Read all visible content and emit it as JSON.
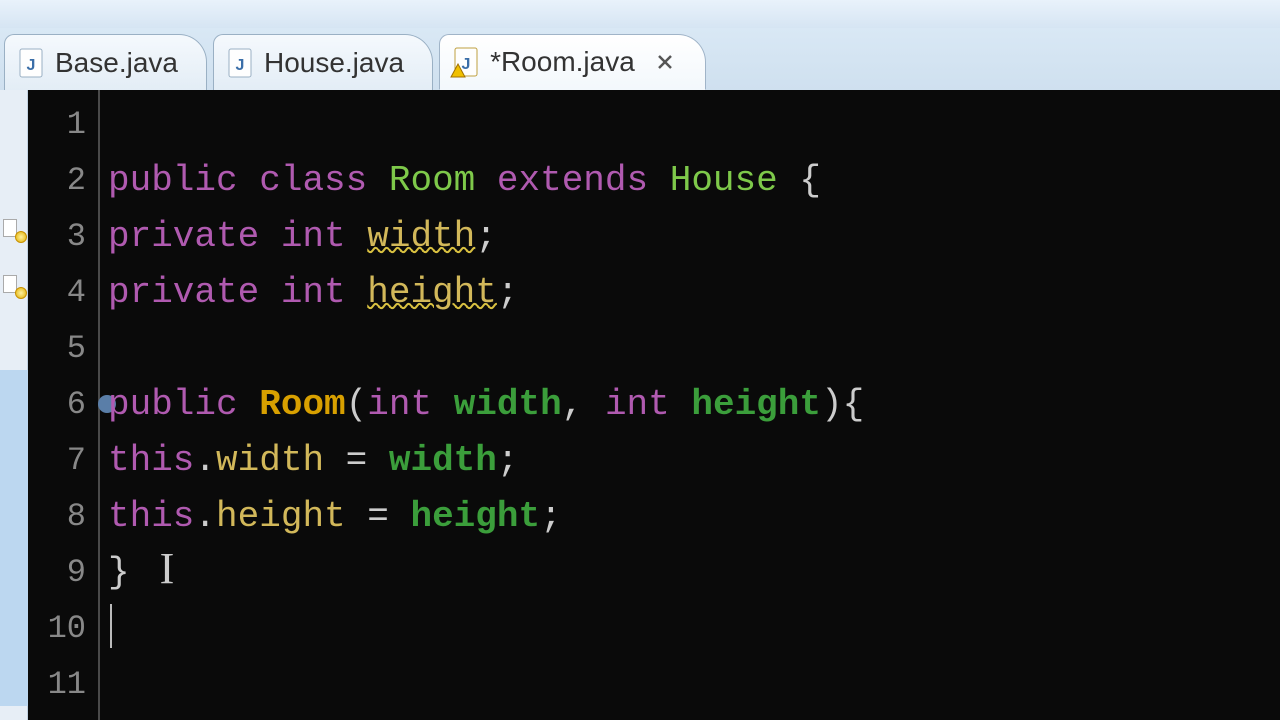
{
  "tabs": [
    {
      "label": "Base.java",
      "active": false,
      "dirty": false,
      "hasWarning": false
    },
    {
      "label": "House.java",
      "active": false,
      "dirty": false,
      "hasWarning": false
    },
    {
      "label": "*Room.java",
      "active": true,
      "dirty": true,
      "hasWarning": true
    }
  ],
  "gutter": {
    "start": 1,
    "end": 11,
    "highlighted": [
      6,
      7,
      8,
      9,
      10,
      11
    ],
    "warningLines": [
      3,
      4
    ],
    "breakpointLine": 6
  },
  "code": {
    "lines": [
      {
        "n": 1,
        "tokens": []
      },
      {
        "n": 2,
        "tokens": [
          {
            "t": "public ",
            "c": "kw"
          },
          {
            "t": "class ",
            "c": "kw"
          },
          {
            "t": "Room ",
            "c": "cls"
          },
          {
            "t": "extends ",
            "c": "kw"
          },
          {
            "t": "House ",
            "c": "cls2"
          },
          {
            "t": "{",
            "c": "punct"
          }
        ]
      },
      {
        "n": 3,
        "indent": 1,
        "tokens": [
          {
            "t": "private ",
            "c": "kw"
          },
          {
            "t": "int ",
            "c": "type1"
          },
          {
            "t": "width",
            "c": "field",
            "wavy": true
          },
          {
            "t": ";",
            "c": "punct"
          }
        ]
      },
      {
        "n": 4,
        "indent": 1,
        "tokens": [
          {
            "t": "private ",
            "c": "kw"
          },
          {
            "t": "int ",
            "c": "type1"
          },
          {
            "t": "height",
            "c": "field",
            "wavy": true
          },
          {
            "t": ";",
            "c": "punct"
          }
        ]
      },
      {
        "n": 5,
        "tokens": []
      },
      {
        "n": 6,
        "indent": 1,
        "tokens": [
          {
            "t": "public ",
            "c": "kw"
          },
          {
            "t": "Room",
            "c": "ctor"
          },
          {
            "t": "(",
            "c": "punct"
          },
          {
            "t": "int ",
            "c": "type1"
          },
          {
            "t": "width",
            "c": "param"
          },
          {
            "t": ", ",
            "c": "punct"
          },
          {
            "t": "int ",
            "c": "type1"
          },
          {
            "t": "height",
            "c": "param"
          },
          {
            "t": "){",
            "c": "punct"
          }
        ]
      },
      {
        "n": 7,
        "indent": 2,
        "tokens": [
          {
            "t": "this",
            "c": "this"
          },
          {
            "t": ".",
            "c": "punct"
          },
          {
            "t": "width",
            "c": "field"
          },
          {
            "t": " = ",
            "c": "punct"
          },
          {
            "t": "width",
            "c": "param"
          },
          {
            "t": ";",
            "c": "punct"
          }
        ]
      },
      {
        "n": 8,
        "indent": 2,
        "tokens": [
          {
            "t": "this",
            "c": "this"
          },
          {
            "t": ".",
            "c": "punct"
          },
          {
            "t": "height",
            "c": "field"
          },
          {
            "t": " = ",
            "c": "punct"
          },
          {
            "t": "height",
            "c": "param"
          },
          {
            "t": ";",
            "c": "punct"
          }
        ]
      },
      {
        "n": 9,
        "indent": 1,
        "tokens": [
          {
            "t": "}",
            "c": "punct"
          }
        ],
        "ibeamAfter": true
      },
      {
        "n": 10,
        "indent": 1,
        "tokens": [],
        "caret": true
      },
      {
        "n": 11,
        "tokens": []
      }
    ]
  },
  "icons": {
    "javaFile": "java-file-icon",
    "close": "close-icon",
    "warning": "warning-icon"
  },
  "colors": {
    "keyword": "#b05ab0",
    "className": "#7ec94a",
    "constructor": "#d8a000",
    "parameter": "#3b9e3b",
    "field": "#d2b85a",
    "editorBg": "#0a0a0a",
    "gutterFg": "#888888"
  }
}
